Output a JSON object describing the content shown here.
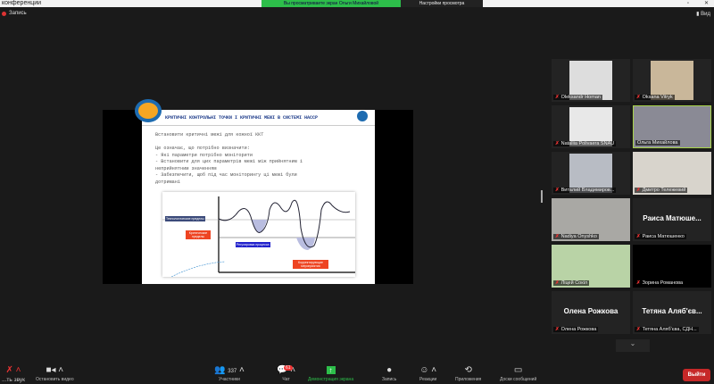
{
  "window": {
    "title": "конференции",
    "banner": "Вы просматриваете экран Ольги Михайловой",
    "view_options": "Настройки просмотра"
  },
  "top": {
    "recording": "Запись",
    "view": "Вид"
  },
  "slide": {
    "title": "КРИТИЧНІ КОНТРОЛЬНІ ТОЧКИ І КРИТИЧНІ МЕЖІ В СИСТЕМІ HACCP",
    "body": "Встановити критичні межі для кожної ККТ\n\nЦе означає, що потрібно визначити:\n- Які параметри потрібно моніторити\n- Встановити для цих параметрів межі між прийнятним і\nнеприйнятним значенням\n- Забезпечити, щоб під час моніторингу ці межі були\nдотримані",
    "chart_labels": {
      "tech": "Технологические пределы",
      "critical": "Критические пределы",
      "regulate": "Регулировка процесса",
      "corrective": "Корректирующие мероприятия"
    }
  },
  "participants": [
    {
      "name": "Oleksandr Homan",
      "video": true
    },
    {
      "name": "Oksana Vitryk",
      "video": true
    },
    {
      "name": "Nataliia Polivaera SNAU",
      "video": true
    },
    {
      "name": "Ольга Михайлова",
      "video": true,
      "active": true
    },
    {
      "name": "Виталий Владимиров...",
      "video": true
    },
    {
      "name": "Дмитро Тележевий",
      "video": true
    },
    {
      "name": "Nadiya Onyshko",
      "video": true
    },
    {
      "name": "Раиса Матюшенко",
      "display": "Раиса Матюше...",
      "video": false
    },
    {
      "name": "Ліцей Сокіл",
      "video": true
    },
    {
      "name": "Зорина Романова",
      "video": false,
      "display": ""
    },
    {
      "name": "Олена Рожкова",
      "display": "Олена Рожкова",
      "video": false
    },
    {
      "name": "Тетяна Аляб'єва, СДН...",
      "display": "Тетяна Аляб'єв...",
      "video": false
    }
  ],
  "toolbar": {
    "mute": "...ть звук",
    "video": "Остановить видео",
    "participants": "Участники",
    "participants_count": "337",
    "chat": "Чат",
    "chat_badge": "61",
    "share": "Демонстрация экрана",
    "record": "Запись",
    "reactions": "Реакции",
    "apps": "Приложения",
    "whiteboards": "Доски сообщений",
    "leave": "Выйти"
  }
}
